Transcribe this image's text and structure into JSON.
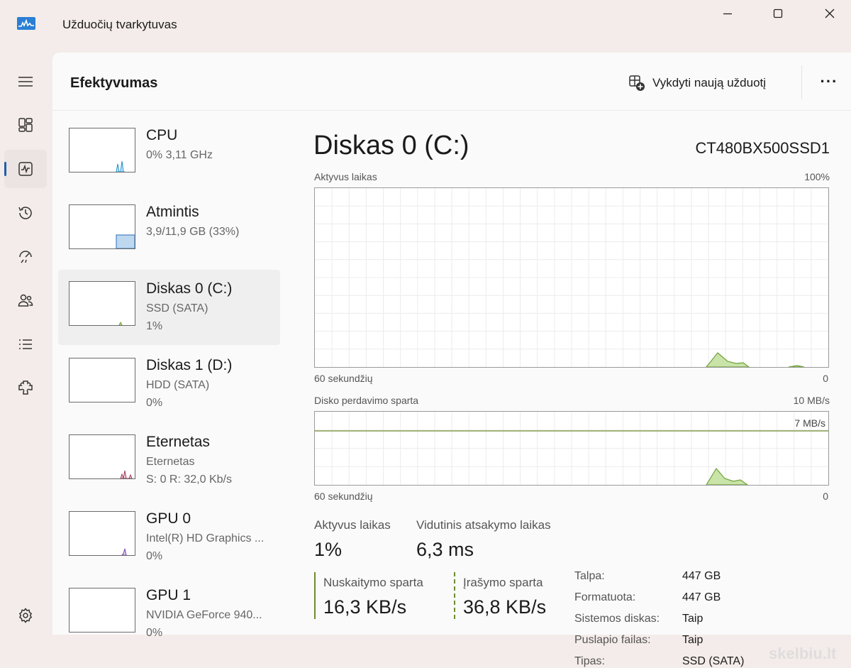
{
  "window": {
    "title": "Užduočių tvarkytuvas"
  },
  "header": {
    "title": "Efektyvumas",
    "run_task_label": "Vykdyti naują užduotį",
    "more_label": "···"
  },
  "nav": [
    {
      "icon": "hamburger-menu-icon"
    },
    {
      "icon": "processes-icon"
    },
    {
      "icon": "performance-icon",
      "active": true
    },
    {
      "icon": "app-history-icon"
    },
    {
      "icon": "startup-apps-icon"
    },
    {
      "icon": "users-icon"
    },
    {
      "icon": "details-icon"
    },
    {
      "icon": "services-icon"
    },
    {
      "icon": "settings-icon"
    }
  ],
  "devices": [
    {
      "name": "CPU",
      "sub1": "0% 3,11 GHz",
      "sub2": "",
      "color": "#1a8fcf",
      "fill": "#d4ebf7"
    },
    {
      "name": "Atmintis",
      "sub1": "3,9/11,9 GB (33%)",
      "sub2": "",
      "color": "#2a6fb8",
      "fill": "#bed8f0"
    },
    {
      "name": "Diskas 0 (C:)",
      "sub1": "SSD (SATA)",
      "sub2": "1%",
      "color": "#6fa23a",
      "fill": "#c9e3a8",
      "selected": true
    },
    {
      "name": "Diskas 1 (D:)",
      "sub1": "HDD (SATA)",
      "sub2": "0%",
      "color": "#6fa23a",
      "fill": "#c9e3a8"
    },
    {
      "name": "Eternetas",
      "sub1": "Eternetas",
      "sub2": "S: 0 R: 32,0 Kb/s",
      "color": "#a03a5a",
      "fill": "#f0d6df"
    },
    {
      "name": "GPU 0",
      "sub1": "Intel(R) HD Graphics ...",
      "sub2": "0%",
      "color": "#7a3cb0",
      "fill": "#e2d3f0"
    },
    {
      "name": "GPU 1",
      "sub1": "NVIDIA GeForce 940...",
      "sub2": "0%",
      "color": "#7a3cb0",
      "fill": "#e2d3f0"
    }
  ],
  "detail": {
    "title": "Diskas 0 (C:)",
    "model": "CT480BX500SSD1",
    "graph1": {
      "label": "Aktyvus laikas",
      "max": "100%",
      "xlabel": "60 sekundžių",
      "min": "0"
    },
    "graph2": {
      "label": "Disko perdavimo sparta",
      "max": "10 MB/s",
      "ref_label": "7 MB/s",
      "xlabel": "60 sekundžių",
      "min": "0"
    },
    "stats": {
      "active_time_label": "Aktyvus laikas",
      "active_time_value": "1%",
      "response_label": "Vidutinis atsakymo laikas",
      "response_value": "6,3 ms",
      "read_label": "Nuskaitymo sparta",
      "read_value": "16,3 KB/s",
      "write_label": "Įrašymo sparta",
      "write_value": "36,8 KB/s"
    },
    "properties": [
      {
        "key": "Talpa:",
        "value": "447 GB"
      },
      {
        "key": "Formatuota:",
        "value": "447 GB"
      },
      {
        "key": "Sistemos diskas:",
        "value": "Taip"
      },
      {
        "key": "Puslapio failas:",
        "value": "Taip"
      },
      {
        "key": "Tipas:",
        "value": "SSD (SATA)"
      }
    ]
  },
  "watermark": "skelbiu.lt"
}
